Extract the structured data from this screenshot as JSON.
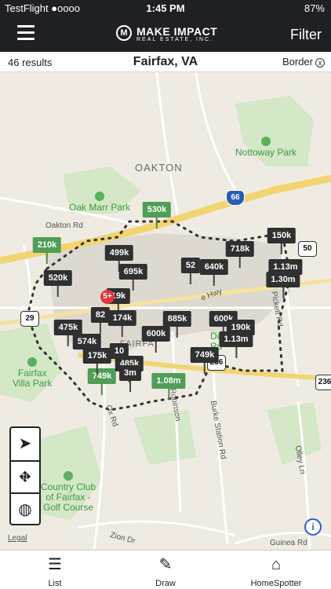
{
  "status_bar": {
    "carrier": "TestFlight ●oooo",
    "time": "1:45 PM",
    "battery": "87%"
  },
  "header": {
    "logo_mark": "M",
    "logo_name": "MAKE IMPACT",
    "logo_sub": "REAL ESTATE, INC.",
    "filter_label": "Filter"
  },
  "results_bar": {
    "count": "46 results",
    "location": "Fairfax, VA",
    "border_label": "Border",
    "border_close": "x"
  },
  "map": {
    "places": [
      {
        "name": "Nottoway Park"
      },
      {
        "name": "Oak Marr Park"
      },
      {
        "name": "Fairfax Villa Park",
        "line1": "Fairfax",
        "line2": "Villa Park"
      },
      {
        "name": "Country Club of Fairfax - Golf Course",
        "line1": "Country Club",
        "line2": "of Fairfax -",
        "line3": "Golf Course"
      },
      {
        "name": "Daniels Run",
        "line1": "Da",
        "line2": "Ru"
      }
    ],
    "towns": [
      "OAKTON",
      "FAIRFA"
    ],
    "roads": [
      "Oakton Rd",
      "Ox Rd",
      "Robinson",
      "Burke Station Rd",
      "Pickett Rd",
      "Olley Ln",
      "Guinea Rd",
      "Zion Dr",
      "e Hwy"
    ],
    "shields": [
      "66",
      "50",
      "29",
      "236",
      "236"
    ],
    "pins": [
      {
        "price": "530k",
        "type": "green"
      },
      {
        "price": "210k",
        "type": "green"
      },
      {
        "price": "749k",
        "type": "green"
      },
      {
        "price": "1.08m",
        "type": "green"
      },
      {
        "price": "718k",
        "type": "dark"
      },
      {
        "price": "150k",
        "type": "dark"
      },
      {
        "price": "499k",
        "type": "dark"
      },
      {
        "price": "520k",
        "type": "dark"
      },
      {
        "price": "695k",
        "type": "dark"
      },
      {
        "price": "52",
        "type": "dark"
      },
      {
        "price": "640k",
        "type": "dark"
      },
      {
        "price": "1.13m",
        "type": "dark"
      },
      {
        "price": "1.30m",
        "type": "dark"
      },
      {
        "price": "19k",
        "type": "dark"
      },
      {
        "price": "82",
        "type": "dark"
      },
      {
        "price": "174k",
        "type": "dark"
      },
      {
        "price": "475k",
        "type": "dark"
      },
      {
        "price": "885k",
        "type": "dark"
      },
      {
        "price": "600k",
        "type": "dark"
      },
      {
        "price": "190k",
        "type": "dark"
      },
      {
        "price": "1.13m",
        "type": "dark"
      },
      {
        "price": "600k",
        "type": "dark"
      },
      {
        "price": "574k",
        "type": "dark"
      },
      {
        "price": "175k",
        "type": "dark"
      },
      {
        "price": "10",
        "type": "dark"
      },
      {
        "price": "485k",
        "type": "dark"
      },
      {
        "price": "3m",
        "type": "dark"
      },
      {
        "price": "749k",
        "type": "dark"
      }
    ],
    "cluster_badge": "5+",
    "legal": "Legal",
    "info": "i"
  },
  "controls": {
    "nav_icon": "location-arrow-icon",
    "road_icon": "road-icon",
    "globe_icon": "globe-icon"
  },
  "tabs": [
    {
      "label": "List",
      "icon": "list-icon"
    },
    {
      "label": "Draw",
      "icon": "pencil-icon"
    },
    {
      "label": "HomeSpotter",
      "icon": "house-icon"
    }
  ]
}
